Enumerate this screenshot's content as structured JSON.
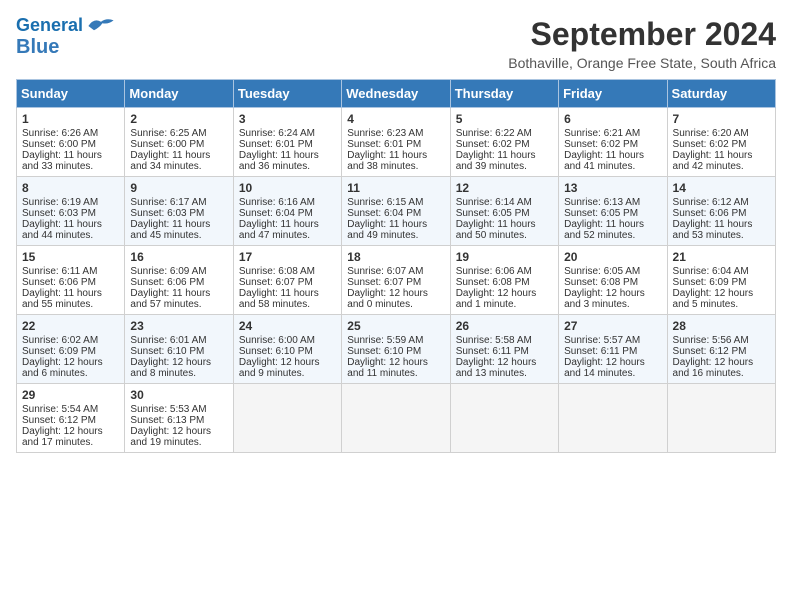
{
  "header": {
    "logo_line1": "General",
    "logo_line2": "Blue",
    "month_year": "September 2024",
    "location": "Bothaville, Orange Free State, South Africa"
  },
  "days_of_week": [
    "Sunday",
    "Monday",
    "Tuesday",
    "Wednesday",
    "Thursday",
    "Friday",
    "Saturday"
  ],
  "weeks": [
    [
      {
        "day": 1,
        "lines": [
          "Sunrise: 6:26 AM",
          "Sunset: 6:00 PM",
          "Daylight: 11 hours",
          "and 33 minutes."
        ]
      },
      {
        "day": 2,
        "lines": [
          "Sunrise: 6:25 AM",
          "Sunset: 6:00 PM",
          "Daylight: 11 hours",
          "and 34 minutes."
        ]
      },
      {
        "day": 3,
        "lines": [
          "Sunrise: 6:24 AM",
          "Sunset: 6:01 PM",
          "Daylight: 11 hours",
          "and 36 minutes."
        ]
      },
      {
        "day": 4,
        "lines": [
          "Sunrise: 6:23 AM",
          "Sunset: 6:01 PM",
          "Daylight: 11 hours",
          "and 38 minutes."
        ]
      },
      {
        "day": 5,
        "lines": [
          "Sunrise: 6:22 AM",
          "Sunset: 6:02 PM",
          "Daylight: 11 hours",
          "and 39 minutes."
        ]
      },
      {
        "day": 6,
        "lines": [
          "Sunrise: 6:21 AM",
          "Sunset: 6:02 PM",
          "Daylight: 11 hours",
          "and 41 minutes."
        ]
      },
      {
        "day": 7,
        "lines": [
          "Sunrise: 6:20 AM",
          "Sunset: 6:02 PM",
          "Daylight: 11 hours",
          "and 42 minutes."
        ]
      }
    ],
    [
      {
        "day": 8,
        "lines": [
          "Sunrise: 6:19 AM",
          "Sunset: 6:03 PM",
          "Daylight: 11 hours",
          "and 44 minutes."
        ]
      },
      {
        "day": 9,
        "lines": [
          "Sunrise: 6:17 AM",
          "Sunset: 6:03 PM",
          "Daylight: 11 hours",
          "and 45 minutes."
        ]
      },
      {
        "day": 10,
        "lines": [
          "Sunrise: 6:16 AM",
          "Sunset: 6:04 PM",
          "Daylight: 11 hours",
          "and 47 minutes."
        ]
      },
      {
        "day": 11,
        "lines": [
          "Sunrise: 6:15 AM",
          "Sunset: 6:04 PM",
          "Daylight: 11 hours",
          "and 49 minutes."
        ]
      },
      {
        "day": 12,
        "lines": [
          "Sunrise: 6:14 AM",
          "Sunset: 6:05 PM",
          "Daylight: 11 hours",
          "and 50 minutes."
        ]
      },
      {
        "day": 13,
        "lines": [
          "Sunrise: 6:13 AM",
          "Sunset: 6:05 PM",
          "Daylight: 11 hours",
          "and 52 minutes."
        ]
      },
      {
        "day": 14,
        "lines": [
          "Sunrise: 6:12 AM",
          "Sunset: 6:06 PM",
          "Daylight: 11 hours",
          "and 53 minutes."
        ]
      }
    ],
    [
      {
        "day": 15,
        "lines": [
          "Sunrise: 6:11 AM",
          "Sunset: 6:06 PM",
          "Daylight: 11 hours",
          "and 55 minutes."
        ]
      },
      {
        "day": 16,
        "lines": [
          "Sunrise: 6:09 AM",
          "Sunset: 6:06 PM",
          "Daylight: 11 hours",
          "and 57 minutes."
        ]
      },
      {
        "day": 17,
        "lines": [
          "Sunrise: 6:08 AM",
          "Sunset: 6:07 PM",
          "Daylight: 11 hours",
          "and 58 minutes."
        ]
      },
      {
        "day": 18,
        "lines": [
          "Sunrise: 6:07 AM",
          "Sunset: 6:07 PM",
          "Daylight: 12 hours",
          "and 0 minutes."
        ]
      },
      {
        "day": 19,
        "lines": [
          "Sunrise: 6:06 AM",
          "Sunset: 6:08 PM",
          "Daylight: 12 hours",
          "and 1 minute."
        ]
      },
      {
        "day": 20,
        "lines": [
          "Sunrise: 6:05 AM",
          "Sunset: 6:08 PM",
          "Daylight: 12 hours",
          "and 3 minutes."
        ]
      },
      {
        "day": 21,
        "lines": [
          "Sunrise: 6:04 AM",
          "Sunset: 6:09 PM",
          "Daylight: 12 hours",
          "and 5 minutes."
        ]
      }
    ],
    [
      {
        "day": 22,
        "lines": [
          "Sunrise: 6:02 AM",
          "Sunset: 6:09 PM",
          "Daylight: 12 hours",
          "and 6 minutes."
        ]
      },
      {
        "day": 23,
        "lines": [
          "Sunrise: 6:01 AM",
          "Sunset: 6:10 PM",
          "Daylight: 12 hours",
          "and 8 minutes."
        ]
      },
      {
        "day": 24,
        "lines": [
          "Sunrise: 6:00 AM",
          "Sunset: 6:10 PM",
          "Daylight: 12 hours",
          "and 9 minutes."
        ]
      },
      {
        "day": 25,
        "lines": [
          "Sunrise: 5:59 AM",
          "Sunset: 6:10 PM",
          "Daylight: 12 hours",
          "and 11 minutes."
        ]
      },
      {
        "day": 26,
        "lines": [
          "Sunrise: 5:58 AM",
          "Sunset: 6:11 PM",
          "Daylight: 12 hours",
          "and 13 minutes."
        ]
      },
      {
        "day": 27,
        "lines": [
          "Sunrise: 5:57 AM",
          "Sunset: 6:11 PM",
          "Daylight: 12 hours",
          "and 14 minutes."
        ]
      },
      {
        "day": 28,
        "lines": [
          "Sunrise: 5:56 AM",
          "Sunset: 6:12 PM",
          "Daylight: 12 hours",
          "and 16 minutes."
        ]
      }
    ],
    [
      {
        "day": 29,
        "lines": [
          "Sunrise: 5:54 AM",
          "Sunset: 6:12 PM",
          "Daylight: 12 hours",
          "and 17 minutes."
        ]
      },
      {
        "day": 30,
        "lines": [
          "Sunrise: 5:53 AM",
          "Sunset: 6:13 PM",
          "Daylight: 12 hours",
          "and 19 minutes."
        ]
      },
      null,
      null,
      null,
      null,
      null
    ]
  ]
}
